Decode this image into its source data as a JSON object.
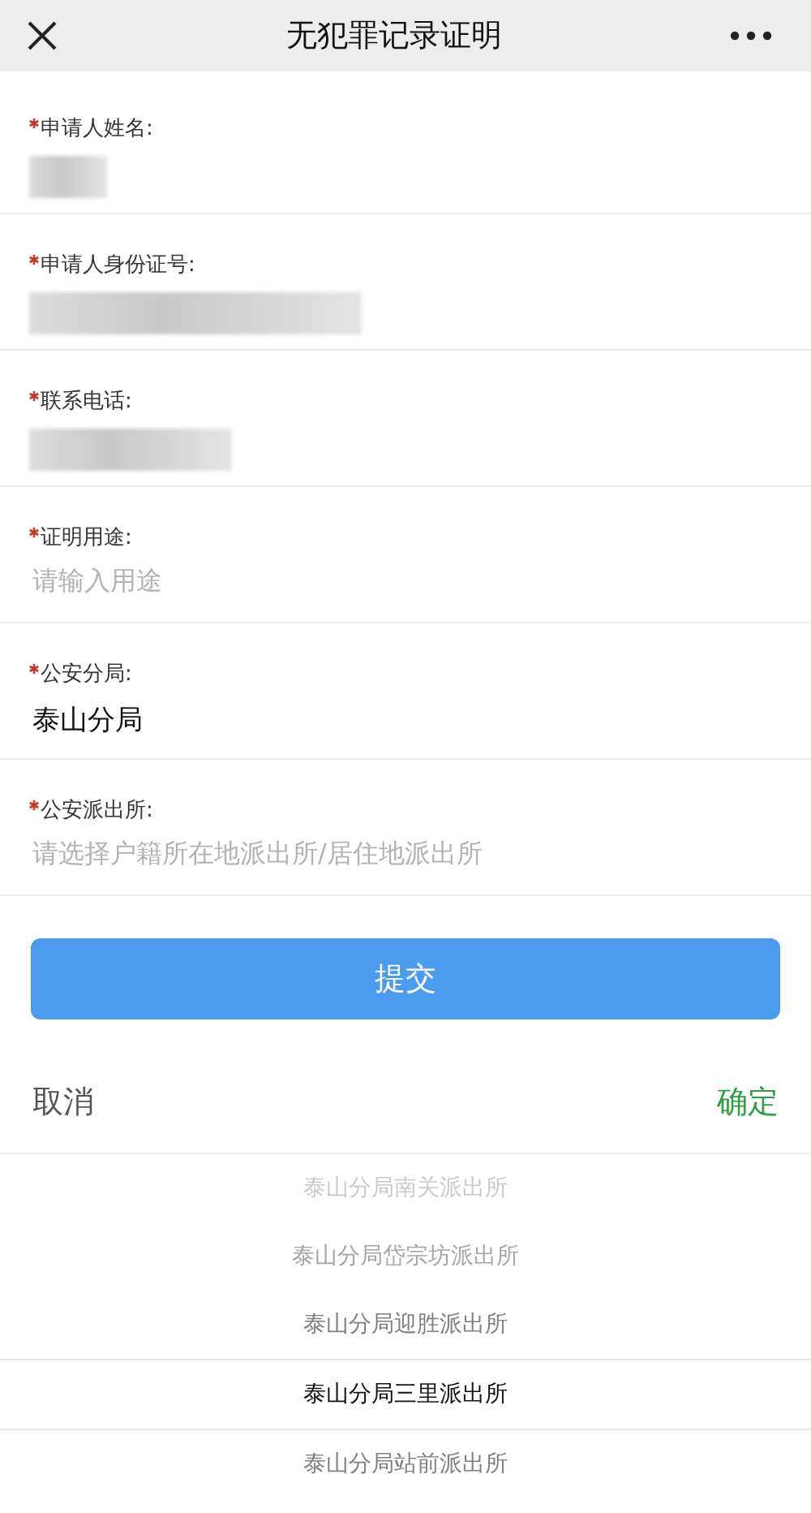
{
  "window": {
    "title": "无犯罪记录证明"
  },
  "fields": [
    {
      "label": "申请人姓名:",
      "required": true,
      "kind": "redacted"
    },
    {
      "label": "申请人身份证号:",
      "required": true,
      "kind": "redacted"
    },
    {
      "label": "联系电话:",
      "required": true,
      "kind": "redacted"
    },
    {
      "label": "证明用途:",
      "required": true,
      "kind": "input",
      "placeholder": "请输入用途"
    },
    {
      "label": "公安分局:",
      "required": true,
      "kind": "select",
      "value": "泰山分局"
    },
    {
      "label": "公安派出所:",
      "required": true,
      "kind": "select",
      "placeholder": "请选择户籍所在地派出所/居住地派出所"
    }
  ],
  "submit_button": "提交",
  "picker": {
    "cancel": "取消",
    "confirm": "确定",
    "options": [
      {
        "label": "泰山分局南关派出所",
        "selected": false
      },
      {
        "label": "泰山分局岱宗坊派出所",
        "selected": false
      },
      {
        "label": "泰山分局迎胜派出所",
        "selected": false
      },
      {
        "label": "泰山分局三里派出所",
        "selected": true
      },
      {
        "label": "泰山分局站前派出所",
        "selected": false
      }
    ]
  }
}
